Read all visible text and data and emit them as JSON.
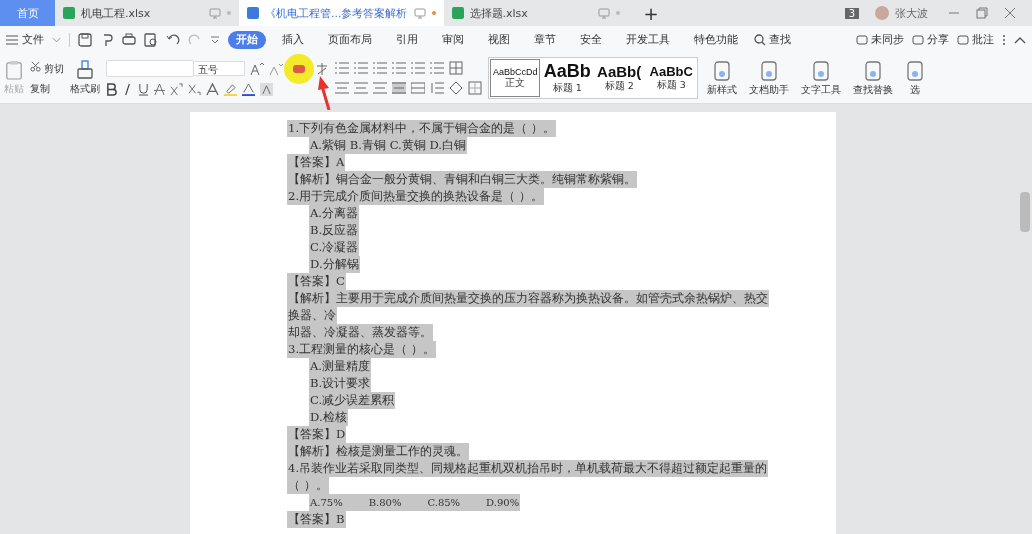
{
  "tabs": [
    {
      "kind": "home",
      "label": "首页",
      "selected": false
    },
    {
      "kind": "sheet",
      "label": "机电工程.xlsx",
      "selected": false
    },
    {
      "kind": "doc",
      "label": "《机电工程管...参考答案解析",
      "selected": true
    },
    {
      "kind": "sheet",
      "label": "选择题.xlsx",
      "selected": false
    }
  ],
  "new_tab": "+",
  "window": {
    "count": "3",
    "user": "张大波"
  },
  "menu": {
    "file": "文件",
    "items": [
      {
        "label": "开始",
        "selected": true
      },
      {
        "label": "插入",
        "selected": false
      },
      {
        "label": "页面布局",
        "selected": false
      },
      {
        "label": "引用",
        "selected": false
      },
      {
        "label": "审阅",
        "selected": false
      },
      {
        "label": "视图",
        "selected": false
      },
      {
        "label": "章节",
        "selected": false
      },
      {
        "label": "安全",
        "selected": false
      },
      {
        "label": "开发工具",
        "selected": false
      },
      {
        "label": "特色功能",
        "selected": false
      }
    ],
    "search": "查找",
    "right": [
      "未同步",
      "分享",
      "批注"
    ]
  },
  "ribbon": {
    "paste": "粘贴",
    "cut": "剪切",
    "copy": "复制",
    "format_painter": "格式刷",
    "font_size": "五号",
    "styles": [
      {
        "sample": "AaBbCcDd",
        "label": "正文",
        "selected": true,
        "kind": "normal"
      },
      {
        "sample": "AaBb",
        "label": "标题 1",
        "selected": false,
        "kind": "h1"
      },
      {
        "sample": "AaBb(",
        "label": "标题 2",
        "selected": false,
        "kind": "h2"
      },
      {
        "sample": "AaBbC",
        "label": "标题 3",
        "selected": false,
        "kind": "h3"
      }
    ],
    "tools": [
      "新样式",
      "文档助手",
      "文字工具",
      "查找替换",
      "选"
    ]
  },
  "document": {
    "lines": [
      {
        "kind": "text",
        "text": "1.下列有色金属材料中，不属于铜合金的是（ ）。",
        "selected": true
      },
      {
        "kind": "option",
        "text": "A.紫铜 B.青铜 C.黄铜 D.白铜",
        "selected": true
      },
      {
        "kind": "text",
        "text": "【答案】A",
        "selected": true
      },
      {
        "kind": "text",
        "text": "【解析】铜合金一般分黄铜、青铜和白铜三大类。纯铜常称紫铜。",
        "selected": true
      },
      {
        "kind": "text",
        "text": "2.用于完成介质间热量交换的换热设备是（ ）。",
        "selected": true
      },
      {
        "kind": "option",
        "text": "A.分离器",
        "selected": true
      },
      {
        "kind": "option",
        "text": "B.反应器",
        "selected": true
      },
      {
        "kind": "option",
        "text": "C.冷凝器",
        "selected": true
      },
      {
        "kind": "option",
        "text": "D.分解锅",
        "selected": true
      },
      {
        "kind": "text",
        "text": "【答案】C",
        "selected": true
      },
      {
        "kind": "text",
        "text": "【解析】主要用于完成介质间热量交换的压力容器称为换热设备。如管壳式余热锅炉、热交",
        "selected": true
      },
      {
        "kind": "text",
        "text": "换器、冷",
        "selected": true
      },
      {
        "kind": "text",
        "text": "却器、冷凝器、蒸发器等。",
        "selected": true
      },
      {
        "kind": "text",
        "text": "3.工程测量的核心是（ ）。",
        "selected": true
      },
      {
        "kind": "option",
        "text": "A.测量精度",
        "selected": true
      },
      {
        "kind": "option",
        "text": "B.设计要求",
        "selected": true
      },
      {
        "kind": "option",
        "text": "C.减少误差累积",
        "selected": true
      },
      {
        "kind": "option",
        "text": "D.检核",
        "selected": true
      },
      {
        "kind": "text",
        "text": "【答案】D",
        "selected": true
      },
      {
        "kind": "text",
        "text": "【解析】检核是测量工作的灵魂。",
        "selected": true
      },
      {
        "kind": "text",
        "text": "4.吊装作业若采取同类型、同规格起重机双机抬吊时，单机载荷最大不得超过额定起重量的",
        "selected": true
      },
      {
        "kind": "text",
        "text": "（ ）。",
        "selected": true
      },
      {
        "kind": "choices",
        "parts": [
          "A.75%",
          "B.80%",
          "C.85%",
          "D.90%"
        ],
        "selected": true
      },
      {
        "kind": "text",
        "text": "【答案】B",
        "selected": true
      }
    ]
  }
}
